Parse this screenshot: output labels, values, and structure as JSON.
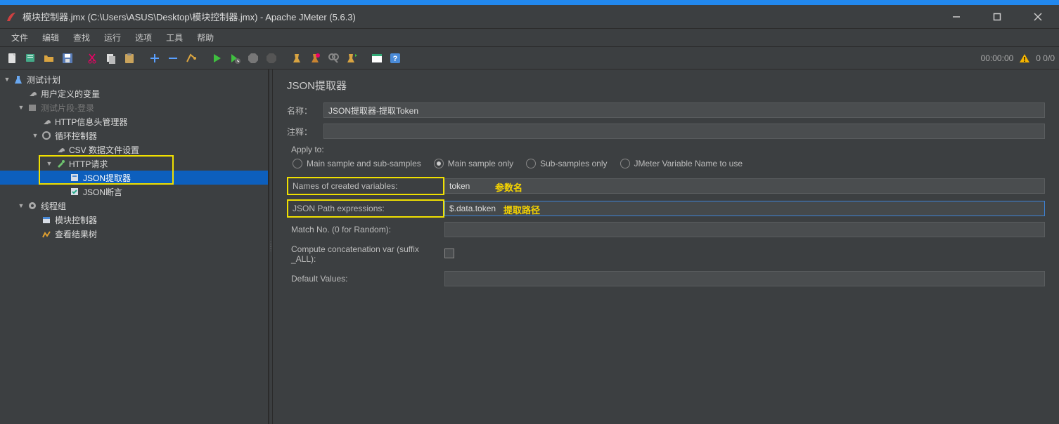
{
  "title": "模块控制器.jmx (C:\\Users\\ASUS\\Desktop\\模块控制器.jmx) - Apache JMeter (5.6.3)",
  "menu": [
    "文件",
    "编辑",
    "查找",
    "运行",
    "选项",
    "工具",
    "帮助"
  ],
  "toolbar_time": "00:00:00",
  "toolbar_counter": "0  0/0",
  "tree": {
    "root": "测试计划",
    "user_vars": "用户定义的变量",
    "frag_login": "测试片段-登录",
    "http_header": "HTTP信息头管理器",
    "loop_ctrl": "循环控制器",
    "csv_data": "CSV 数据文件设置",
    "http_req": "HTTP请求",
    "json_ext": "JSON提取器",
    "json_assert": "JSON断言",
    "thread_group": "线程组",
    "module_ctrl": "模块控制器",
    "view_results": "查看结果树"
  },
  "panel": {
    "title": "JSON提取器",
    "name_label": "名称：",
    "name_value": "JSON提取器-提取Token",
    "comment_label": "注释：",
    "comment_value": "",
    "apply_to": "Apply to:",
    "radio_main_sub": "Main sample and sub-samples",
    "radio_main_only": "Main sample only",
    "radio_sub_only": "Sub-samples only",
    "radio_var": "JMeter Variable Name to use",
    "names_vars": "Names of created variables:",
    "names_vars_value": "token",
    "json_path": "JSON Path expressions:",
    "json_path_value": "$.data.token",
    "match_no": "Match No. (0 for Random):",
    "match_no_value": "",
    "compute_concat": "Compute concatenation var (suffix _ALL):",
    "default_values": "Default Values:",
    "default_values_value": ""
  },
  "annotations": {
    "param_name": "参数名",
    "extract_path": "提取路径"
  }
}
